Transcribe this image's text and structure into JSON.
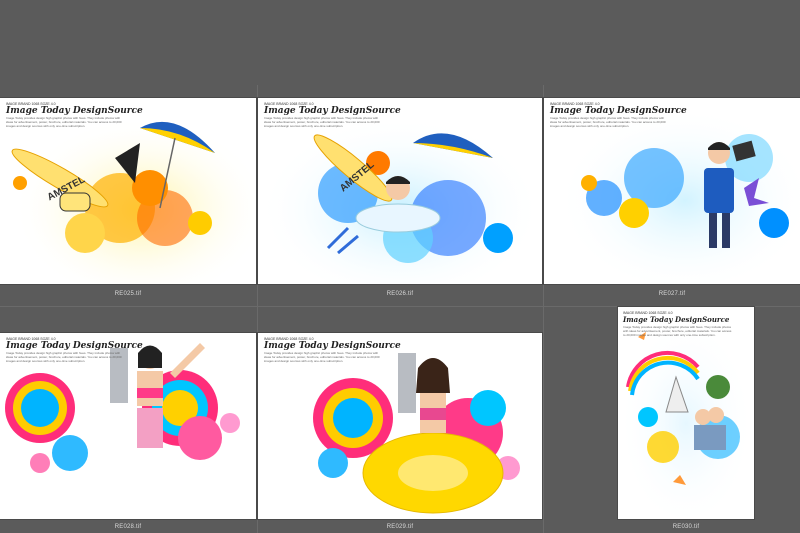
{
  "thumbnails": [
    {
      "caption": "RE025.tif",
      "header_small": "IMAGE BRAND  1068 SOZE 4.0",
      "header_script": "Image Today DesignSource",
      "header_blurb": "Image Today provides design high graphic photos with hues. They include photos with ideas for advertisement, poster, brochure, editorial materials. You can access to 20,000 images and design sources with only one-time subscription.",
      "surfboard_text": "AMSTEL"
    },
    {
      "caption": "RE026.tif",
      "header_small": "IMAGE BRAND  1068 SOZE 4.0",
      "header_script": "Image Today DesignSource",
      "header_blurb": "Image Today provides design high graphic photos with hues. They include photos with ideas for advertisement, poster, brochure, editorial materials. You can access to 20,000 images and design sources with only one-time subscription.",
      "surfboard_text": "AMSTEL"
    },
    {
      "caption": "RE027.tif",
      "header_small": "IMAGE BRAND  1068 SOZE 4.0",
      "header_script": "Image Today DesignSource",
      "header_blurb": "Image Today provides design high graphic photos with hues. They include photos with ideas for advertisement, poster, brochure, editorial materials. You can access to 20,000 images and design sources with only one-time subscription."
    },
    {
      "caption": "RE028.tif",
      "header_small": "IMAGE BRAND  1068 SOZE 4.0",
      "header_script": "Image Today DesignSource",
      "header_blurb": "Image Today provides design high graphic photos with hues. They include photos with ideas for advertisement, poster, brochure, editorial materials. You can access to 20,000 images and design sources with only one-time subscription."
    },
    {
      "caption": "RE029.tif",
      "header_small": "IMAGE BRAND  1068 SOZE 4.0",
      "header_script": "Image Today DesignSource",
      "header_blurb": "Image Today provides design high graphic photos with hues. They include photos with ideas for advertisement, poster, brochure, editorial materials. You can access to 20,000 images and design sources with only one-time subscription."
    },
    {
      "caption": "RE030.tif",
      "header_small": "IMAGE BRAND  1068 SOZE 4.0",
      "header_script": "Image Today DesignSource",
      "header_blurb": "Image Today provides design high graphic photos with hues. They include photos with ideas for advertisement, poster, brochure, editorial materials. You can access to 20,000 images and design sources with only one-time subscription."
    }
  ],
  "colors": {
    "background": "#5b5b5b",
    "thumb_bg": "#ffffff",
    "caption": "#d8d8d8"
  }
}
